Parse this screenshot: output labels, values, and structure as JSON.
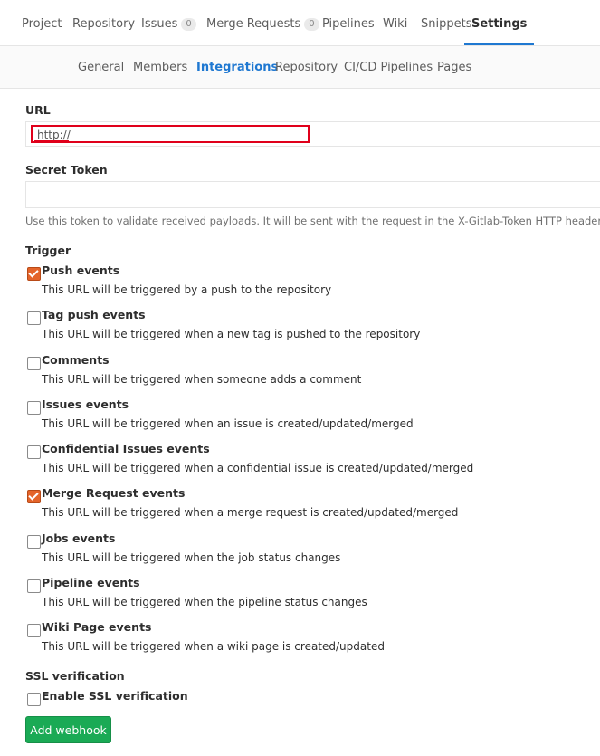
{
  "top_nav": {
    "tabs": [
      {
        "label": "Project"
      },
      {
        "label": "Repository"
      },
      {
        "label": "Issues",
        "count": "0"
      },
      {
        "label": "Merge Requests",
        "count": "0"
      },
      {
        "label": "Pipelines"
      },
      {
        "label": "Wiki"
      },
      {
        "label": "Snippets"
      },
      {
        "label": "Settings",
        "active": true
      }
    ]
  },
  "sub_nav": {
    "tabs": [
      {
        "label": "General"
      },
      {
        "label": "Members"
      },
      {
        "label": "Integrations",
        "active": true
      },
      {
        "label": "Repository"
      },
      {
        "label": "CI/CD Pipelines"
      },
      {
        "label": "Pages"
      }
    ]
  },
  "form": {
    "url": {
      "label": "URL",
      "value": "http://"
    },
    "secret_token": {
      "label": "Secret Token",
      "value": "",
      "help": "Use this token to validate received payloads. It will be sent with the request in the X-Gitlab-Token HTTP header."
    },
    "trigger_label": "Trigger",
    "triggers": [
      {
        "title": "Push events",
        "description": "This URL will be triggered by a push to the repository",
        "checked": true
      },
      {
        "title": "Tag push events",
        "description": "This URL will be triggered when a new tag is pushed to the repository",
        "checked": false
      },
      {
        "title": "Comments",
        "description": "This URL will be triggered when someone adds a comment",
        "checked": false
      },
      {
        "title": "Issues events",
        "description": "This URL will be triggered when an issue is created/updated/merged",
        "checked": false
      },
      {
        "title": "Confidential Issues events",
        "description": "This URL will be triggered when a confidential issue is created/updated/merged",
        "checked": false
      },
      {
        "title": "Merge Request events",
        "description": "This URL will be triggered when a merge request is created/updated/merged",
        "checked": true
      },
      {
        "title": "Jobs events",
        "description": "This URL will be triggered when the job status changes",
        "checked": false
      },
      {
        "title": "Pipeline events",
        "description": "This URL will be triggered when the pipeline status changes",
        "checked": false
      },
      {
        "title": "Wiki Page events",
        "description": "This URL will be triggered when a wiki page is created/updated",
        "checked": false
      }
    ],
    "ssl": {
      "label": "SSL verification",
      "option": "Enable SSL verification",
      "checked": false
    },
    "submit_label": "Add webhook"
  },
  "colors": {
    "accent": "#1f78d1",
    "checkbox_checked": "#e4642a",
    "submit": "#1aaa55",
    "highlight": "#e0001b"
  }
}
